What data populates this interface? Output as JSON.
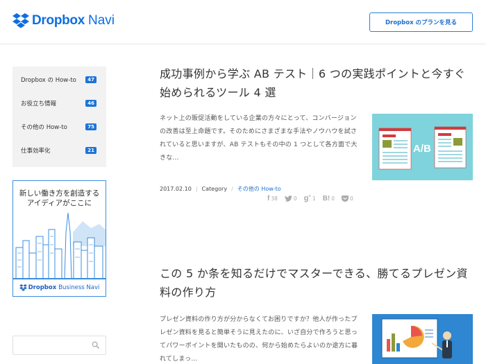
{
  "header": {
    "logo_brand": "Dropbox",
    "logo_suffix": "Navi",
    "plan_button": "Dropbox のプランを見る"
  },
  "sidebar": {
    "categories": [
      {
        "label": "Dropbox の How-to",
        "count": "47"
      },
      {
        "label": "お役立ち情報",
        "count": "46"
      },
      {
        "label": "その他の How-to",
        "count": "75"
      },
      {
        "label": "仕事効率化",
        "count": "21"
      }
    ],
    "banner": {
      "line1": "新しい働き方を創造する",
      "line2": "アイディアがここに",
      "brand": "Dropbox",
      "suffix": "Business Navi"
    },
    "search": {
      "placeholder": ""
    }
  },
  "articles": [
    {
      "title": "成功事例から学ぶ AB テスト｜6 つの実践ポイントと今すぐ始められるツール 4 選",
      "excerpt": "ネット上の販促活動をしている企業の方々にとって、コンバージョンの改善は至上命題です。そのためにさまざまな手法やノウハウを試されていると思いますが、AB テストもその中の 1 つとして各方面で大きな…",
      "thumb_label": "A/B",
      "date": "2017.02.10",
      "category_label": "Category",
      "category": "その他の How-to",
      "shares": {
        "facebook": "38",
        "twitter": "0",
        "googleplus": "1",
        "hatena": "0",
        "pocket": "0"
      }
    },
    {
      "title": "この 5 か条を知るだけでマスターできる、勝てるプレゼン資料の作り方",
      "excerpt": "プレゼン資料の作り方が分からなくてお困りですか？他人が作ったプレゼン資料を見ると簡単そうに見えたのに、いざ自分で作ろうと思ってパワーポイントを開いたものの、何から始めたらよいのか途方に暮れてしまっ…"
    }
  ],
  "colors": {
    "brand": "#0d6ee0",
    "badge": "#1e73d7",
    "thumb1_bg": "#7fd3dc",
    "thumb2_bg": "#2e87d0"
  }
}
